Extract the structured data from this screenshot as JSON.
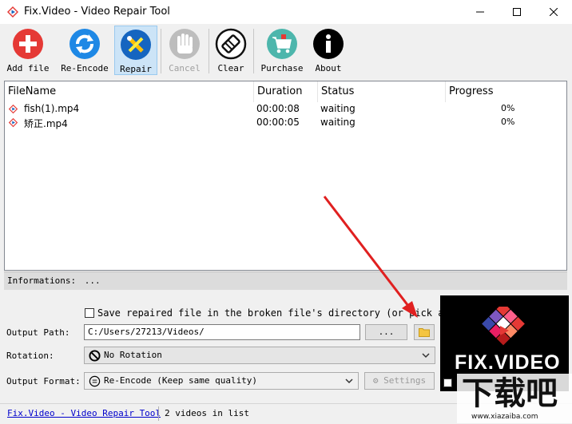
{
  "window": {
    "title": "Fix.Video - Video Repair Tool"
  },
  "toolbar": {
    "buttons": [
      {
        "label": "Add file",
        "icon": "plus-icon",
        "color": "#e53935"
      },
      {
        "label": "Re-Encode",
        "icon": "refresh-icon",
        "color": "#1e88e5"
      },
      {
        "label": "Repair",
        "icon": "wrench-screwdriver-icon",
        "color": "#1565c0"
      },
      {
        "label": "Cancel",
        "icon": "hand-stop-icon",
        "color": "#b0b0b0"
      },
      {
        "label": "Clear",
        "icon": "eraser-icon",
        "color": "#111111"
      },
      {
        "label": "Purchase",
        "icon": "shopping-cart-icon",
        "color": "#26a69a"
      },
      {
        "label": "About",
        "icon": "info-icon",
        "color": "#000000"
      }
    ]
  },
  "file_list": {
    "columns": [
      "FileName",
      "Duration",
      "Status",
      "Progress"
    ],
    "rows": [
      {
        "name": "fish(1).mp4",
        "duration": "00:00:08",
        "status": "waiting",
        "progress": "0%"
      },
      {
        "name": "矫正.mp4",
        "duration": "00:00:05",
        "status": "waiting",
        "progress": "0%"
      }
    ]
  },
  "info": {
    "label": "Informations:",
    "value": "..."
  },
  "options": {
    "save_in_source_label": "Save repaired file in the broken file's directory (or pick an output p",
    "output_path_label": "Output Path:",
    "output_path_value": "C:/Users/27213/Videos/",
    "browse_label": "...",
    "rotation_label": "Rotation:",
    "rotation_value": "No Rotation",
    "output_format_label": "Output Format:",
    "output_format_value": "Re-Encode (Keep same quality)",
    "settings_label": "Settings"
  },
  "status_bar": {
    "link": "Fix.Video - Video Repair Tool",
    "count": "2 videos in list"
  },
  "logo": {
    "text": "FIX.VIDEO"
  },
  "watermark": {
    "text": "下载吧",
    "url": "www.xiazaiba.com"
  },
  "colors": {
    "accent_blue": "#0078d7",
    "arrow_red": "#e02020"
  }
}
